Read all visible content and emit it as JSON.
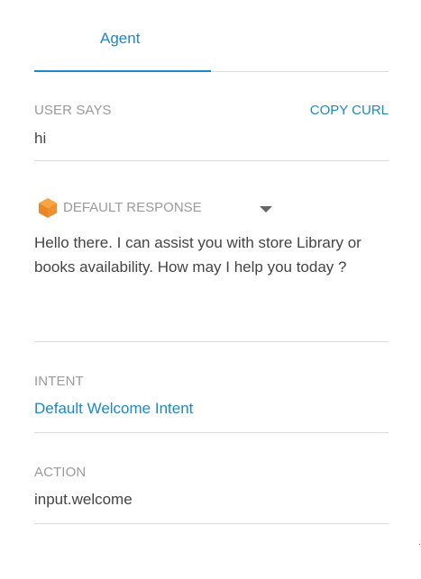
{
  "tabs": {
    "agent_label": "Agent"
  },
  "user_says": {
    "label": "USER SAYS",
    "copy_curl_label": "COPY CURL",
    "value": "hi"
  },
  "default_response": {
    "icon": "cube-icon",
    "label": "DEFAULT RESPONSE",
    "text": "Hello there. I can assist you with store Library or books availability. How may I help you today ?"
  },
  "intent": {
    "label": "INTENT",
    "value": "Default Welcome Intent"
  },
  "action": {
    "label": "ACTION",
    "value": "input.welcome"
  },
  "colors": {
    "accent": "#1e88c7",
    "label_gray": "#9a9a9a",
    "text": "#444444",
    "divider": "#dcdcdc",
    "icon_orange": "#f0902c"
  }
}
